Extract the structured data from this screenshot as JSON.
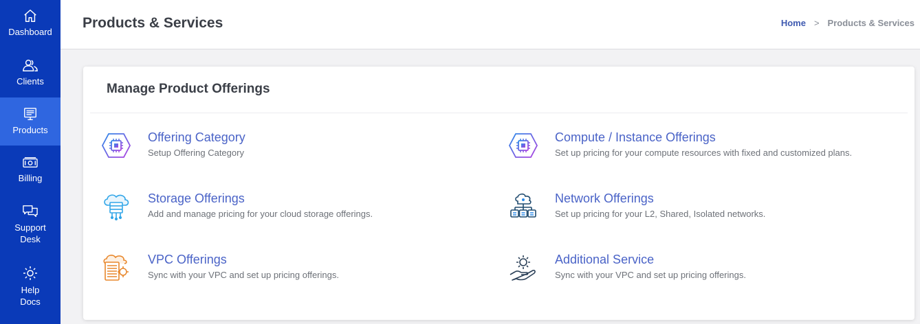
{
  "sidebar": {
    "items": [
      {
        "label": "Dashboard",
        "icon": "home-icon"
      },
      {
        "label": "Clients",
        "icon": "users-icon"
      },
      {
        "label": "Products",
        "icon": "products-icon",
        "active": true
      },
      {
        "label": "Billing",
        "icon": "billing-icon"
      },
      {
        "label": "Support Desk",
        "icon": "support-chat-icon"
      },
      {
        "label": "Help Docs",
        "icon": "help-gear-icon"
      }
    ]
  },
  "header": {
    "title": "Products & Services",
    "breadcrumb": {
      "home": "Home",
      "separator": ">",
      "current": "Products & Services"
    }
  },
  "card": {
    "title": "Manage Product Offerings",
    "offerings": [
      {
        "title": "Offering Category",
        "desc": "Setup Offering Category",
        "icon": "chip-hexagon-icon"
      },
      {
        "title": "Compute / Instance Offerings",
        "desc": "Set up pricing for your compute resources with fixed and customized plans.",
        "icon": "chip-hexagon-icon"
      },
      {
        "title": "Storage Offerings",
        "desc": "Add and manage pricing for your cloud storage offerings.",
        "icon": "cloud-storage-icon"
      },
      {
        "title": "Network Offerings",
        "desc": "Set up pricing for your L2, Shared, Isolated networks.",
        "icon": "network-icon"
      },
      {
        "title": "VPC Offerings",
        "desc": "Sync with your VPC and set up pricing offerings.",
        "icon": "vpc-server-icon"
      },
      {
        "title": "Additional Service",
        "desc": "Sync with your VPC and set up pricing offerings.",
        "icon": "gear-hand-icon"
      }
    ]
  },
  "colors": {
    "sidebar_bg": "#0a3ab8",
    "sidebar_active": "#2f66e0",
    "accent_text": "#4a63c7",
    "compute_gradient": [
      "#2a8ae8",
      "#b040e0"
    ],
    "storage_icon": "#32a6e8",
    "network_icon": "#1f4a6e",
    "vpc_icon": "#e8862a",
    "service_icon": "#2b4058"
  }
}
